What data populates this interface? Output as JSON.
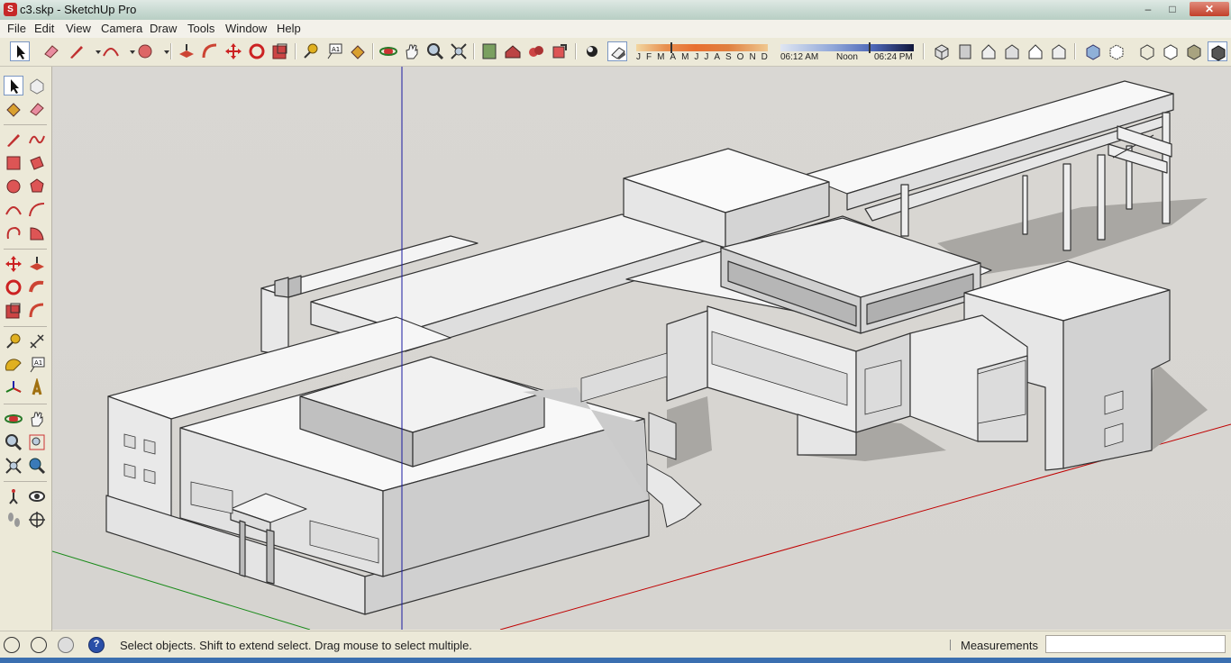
{
  "window": {
    "title": "c3.skp - SketchUp Pro",
    "app_icon": "sketchup-icon",
    "min": "‒",
    "max": "□",
    "close": "✕"
  },
  "menu": [
    "File",
    "Edit",
    "View",
    "Camera",
    "Draw",
    "Tools",
    "Window",
    "Help"
  ],
  "shadow": {
    "months": [
      "J",
      "F",
      "M",
      "A",
      "M",
      "J",
      "J",
      "A",
      "S",
      "O",
      "N",
      "D"
    ],
    "time_start": "06:12 AM",
    "time_mid": "Noon",
    "time_end": "06:24 PM"
  },
  "statusbar": {
    "hint": "Select objects. Shift to extend select. Drag mouse to select multiple.",
    "measurements_label": "Measurements",
    "measurements_value": "",
    "help_icon": "?"
  },
  "colors": {
    "red_axis": "#c00000",
    "green_axis": "#1a8a1a",
    "blue_axis": "#1a1aa0",
    "sky": "#d8d6d2"
  }
}
